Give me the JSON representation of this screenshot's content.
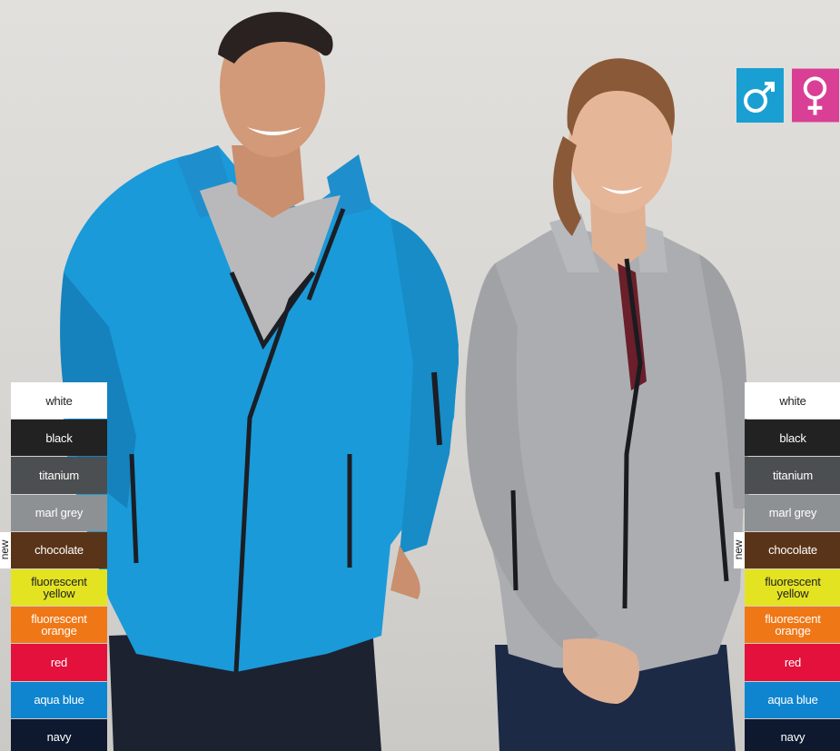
{
  "gender_badges": [
    {
      "name": "male",
      "symbol": "♂",
      "color": "#1a9fd3"
    },
    {
      "name": "female",
      "symbol": "♀",
      "color": "#d93f95"
    }
  ],
  "new_label": "new",
  "colors_left": [
    {
      "label": "white",
      "bg": "#ffffff",
      "fg": "#222222"
    },
    {
      "label": "black",
      "bg": "#222222",
      "fg": "#ffffff"
    },
    {
      "label": "titanium",
      "bg": "#4c4f51",
      "fg": "#ffffff"
    },
    {
      "label": "marl grey",
      "bg": "#8e9194",
      "fg": "#ffffff"
    },
    {
      "label": "chocolate",
      "bg": "#5a3418",
      "fg": "#ffffff"
    },
    {
      "label": "fluorescent yellow",
      "bg": "#e3e322",
      "fg": "#222222"
    },
    {
      "label": "fluorescent orange",
      "bg": "#f07716",
      "fg": "#ffffff"
    },
    {
      "label": "red",
      "bg": "#e3113b",
      "fg": "#ffffff"
    },
    {
      "label": "aqua blue",
      "bg": "#0f84cf",
      "fg": "#ffffff"
    },
    {
      "label": "navy",
      "bg": "#0e1930",
      "fg": "#ffffff"
    }
  ],
  "colors_right": [
    {
      "label": "white",
      "bg": "#ffffff",
      "fg": "#222222"
    },
    {
      "label": "black",
      "bg": "#222222",
      "fg": "#ffffff"
    },
    {
      "label": "titanium",
      "bg": "#4c4f51",
      "fg": "#ffffff"
    },
    {
      "label": "marl grey",
      "bg": "#8e9194",
      "fg": "#ffffff"
    },
    {
      "label": "chocolate",
      "bg": "#5a3418",
      "fg": "#ffffff"
    },
    {
      "label": "fluorescent yellow",
      "bg": "#e3e322",
      "fg": "#222222"
    },
    {
      "label": "fluorescent orange",
      "bg": "#f07716",
      "fg": "#ffffff"
    },
    {
      "label": "red",
      "bg": "#e3113b",
      "fg": "#ffffff"
    },
    {
      "label": "aqua blue",
      "bg": "#0f84cf",
      "fg": "#ffffff"
    },
    {
      "label": "navy",
      "bg": "#0e1930",
      "fg": "#ffffff"
    }
  ],
  "new_index": 4
}
